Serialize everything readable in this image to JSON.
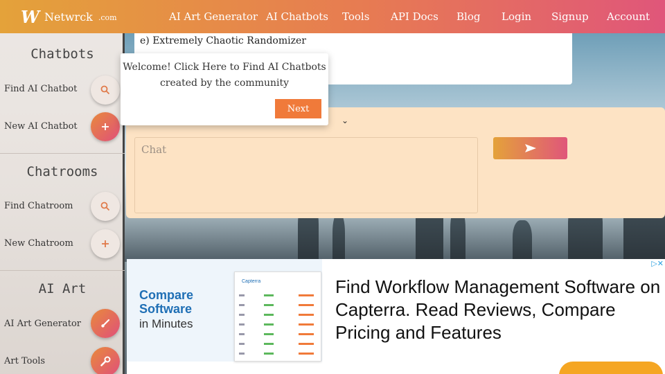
{
  "header": {
    "logo_mark": "W",
    "brand": "Netwrck",
    "tld": ".com",
    "nav": [
      "AI Art Generator",
      "AI Chatbots",
      "Tools",
      "API Docs",
      "Blog",
      "Login",
      "Signup",
      "Account"
    ]
  },
  "sidebar": {
    "sections": [
      {
        "title": "Chatbots",
        "items": [
          {
            "label": "Find AI Chatbot",
            "icon": "search-icon"
          },
          {
            "label": "New AI Chatbot",
            "icon": "plus-icon"
          }
        ]
      },
      {
        "title": "Chatrooms",
        "items": [
          {
            "label": "Find Chatroom",
            "icon": "search-icon"
          },
          {
            "label": "New Chatroom",
            "icon": "plus-icon"
          }
        ]
      },
      {
        "title": "AI Art",
        "items": [
          {
            "label": "AI Art Generator",
            "icon": "brush-icon"
          },
          {
            "label": "Art Tools",
            "icon": "wrench-icon"
          }
        ]
      }
    ]
  },
  "top_panel": {
    "option_text": "e)  Extremely  Chaotic  Randomizer"
  },
  "tooltip": {
    "line1": "Welcome!  Click  Here  to  Find  AI  Chatbots",
    "line2": "created  by  the  community",
    "next_label": "Next"
  },
  "chat": {
    "placeholder": "Chat",
    "send_icon": "send-icon"
  },
  "ad": {
    "left_line1": "Compare",
    "left_line2": "Software",
    "left_line3": "in Minutes",
    "screenshot_brand": "Capterra",
    "headline": "Find Workflow Management Software on Capterra. Read Reviews, Compare Pricing and Features",
    "adchoices_icon": "adchoices-icon"
  },
  "colors": {
    "header_start": "#e4a23a",
    "header_end": "#e0567a",
    "accent": "#f07a3a",
    "chat_bg": "#fde3c4",
    "ad_blue": "#1f6fb5"
  }
}
